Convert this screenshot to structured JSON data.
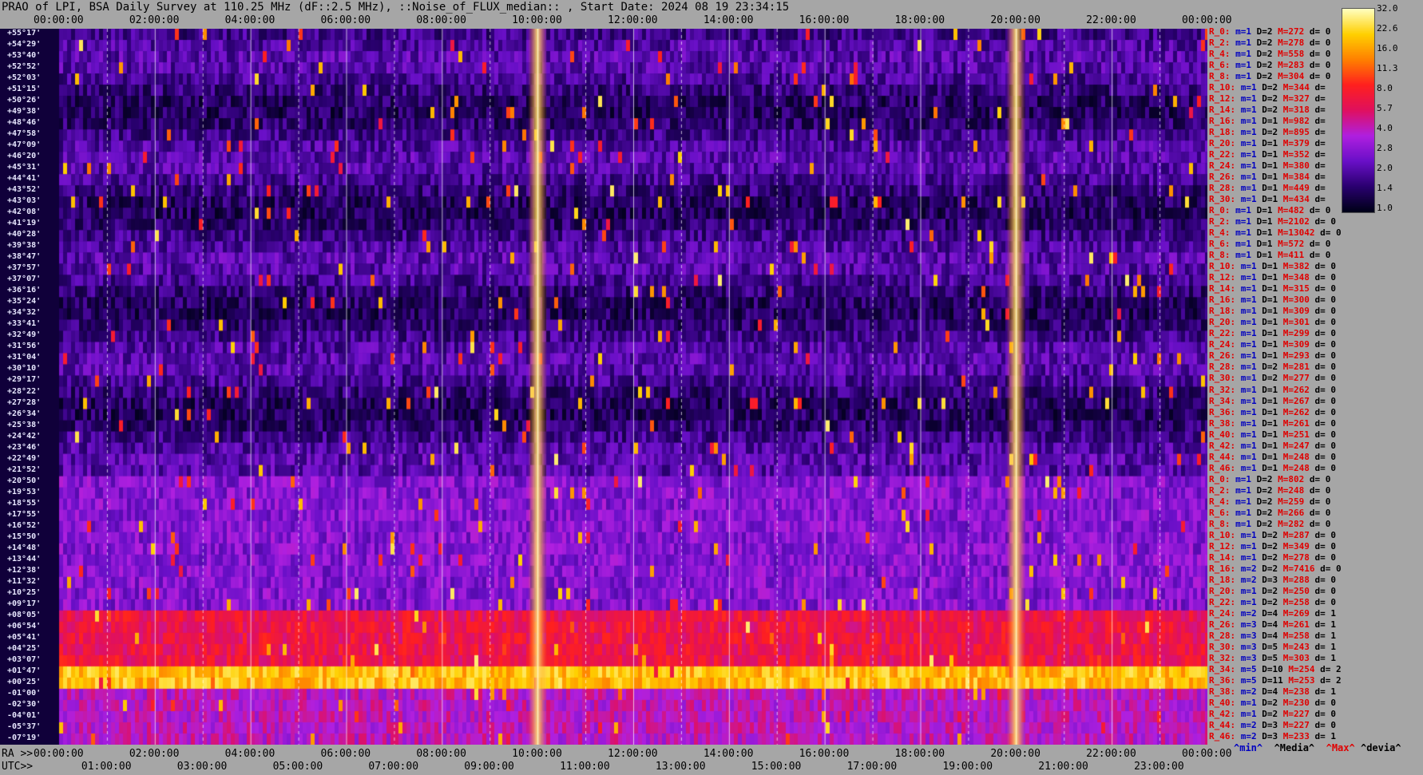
{
  "title": "PRAO of LPI, BSA Daily Survey at 110.25 MHz (dF::2.5 MHz), ::Noise_of_FLUX_median:: , Start Date: 2024 08 19 23:34:15",
  "top_time_labels": [
    "00:00:00",
    "02:00:00",
    "04:00:00",
    "06:00:00",
    "08:00:00",
    "10:00:00",
    "12:00:00",
    "14:00:00",
    "16:00:00",
    "18:00:00",
    "20:00:00",
    "22:00:00",
    "00:00:00"
  ],
  "bottom_ra_prefix": "RA >>",
  "bottom_ra_labels": [
    "00:00:00",
    "02:00:00",
    "04:00:00",
    "06:00:00",
    "08:00:00",
    "10:00:00",
    "12:00:00",
    "14:00:00",
    "16:00:00",
    "18:00:00",
    "20:00:00",
    "22:00:00",
    "00:00:00"
  ],
  "bottom_utc_prefix": "UTC>>",
  "bottom_utc_labels": [
    "01:00:00",
    "03:00:00",
    "05:00:00",
    "07:00:00",
    "09:00:00",
    "11:00:00",
    "13:00:00",
    "15:00:00",
    "17:00:00",
    "19:00:00",
    "21:00:00",
    "23:00:00"
  ],
  "declinations": [
    "+55°17'",
    "+54°29'",
    "+53°40'",
    "+52°52'",
    "+52°03'",
    "+51°15'",
    "+50°26'",
    "+49°38'",
    "+48°46'",
    "+47°58'",
    "+47°09'",
    "+46°20'",
    "+45°31'",
    "+44°41'",
    "+43°52'",
    "+43°03'",
    "+42°08'",
    "+41°19'",
    "+40°28'",
    "+39°38'",
    "+38°47'",
    "+37°57'",
    "+37°07'",
    "+36°16'",
    "+35°24'",
    "+34°32'",
    "+33°41'",
    "+32°49'",
    "+31°56'",
    "+31°04'",
    "+30°10'",
    "+29°17'",
    "+28°22'",
    "+27°28'",
    "+26°34'",
    "+25°38'",
    "+24°42'",
    "+23°46'",
    "+22°49'",
    "+21°52'",
    "+20°50'",
    "+19°53'",
    "+18°55'",
    "+17°55'",
    "+16°52'",
    "+15°50'",
    "+14°48'",
    "+13°44'",
    "+12°38'",
    "+11°32'",
    "+10°25'",
    "+09°17'",
    "+08°05'",
    "+06°54'",
    "+05°41'",
    "+04°25'",
    "+03°07'",
    "+01°47'",
    "+00°25'",
    "-01°00'",
    "-02°30'",
    "-04°01'",
    "-05°37'",
    "-07°19'"
  ],
  "row_labels": [
    "R_0:",
    "R_2:",
    "R_4:",
    "R_6:",
    "R_8:",
    "R_10:",
    "R_12:",
    "R_14:",
    "R_16:",
    "R_18:",
    "R_20:",
    "R_22:",
    "R_24:",
    "R_26:",
    "R_28:",
    "R_30:",
    "R_0:",
    "R_2:",
    "R_4:",
    "R_6:",
    "R_8:",
    "R_10:",
    "R_12:",
    "R_14:",
    "R_16:",
    "R_18:",
    "R_20:",
    "R_22:",
    "R_24:",
    "R_26:",
    "R_28:",
    "R_30:",
    "R_32:",
    "R_34:",
    "R_36:",
    "R_38:",
    "R_40:",
    "R_42:",
    "R_44:",
    "R_46:",
    "R_0:",
    "R_2:",
    "R_4:",
    "R_6:",
    "R_8:",
    "R_10:",
    "R_12:",
    "R_14:",
    "R_16:",
    "R_18:",
    "R_20:",
    "R_22:",
    "R_24:",
    "R_26:",
    "R_28:",
    "R_30:",
    "R_32:",
    "R_34:",
    "R_36:",
    "R_38:",
    "R_40:",
    "R_42:",
    "R_44:",
    "R_46:"
  ],
  "row_stats": [
    {
      "m": "m=1",
      "D": "D=2",
      "M": "M=272",
      "d": "d= 0"
    },
    {
      "m": "m=1",
      "D": "D=2",
      "M": "M=278",
      "d": "d= 0"
    },
    {
      "m": "m=1",
      "D": "D=2",
      "M": "M=558",
      "d": "d= 0"
    },
    {
      "m": "m=1",
      "D": "D=2",
      "M": "M=283",
      "d": "d= 0"
    },
    {
      "m": "m=1",
      "D": "D=2",
      "M": "M=304",
      "d": "d= 0"
    },
    {
      "m": "m=1",
      "D": "D=2",
      "M": "M=344",
      "d": "d="
    },
    {
      "m": "m=1",
      "D": "D=2",
      "M": "M=327",
      "d": "d="
    },
    {
      "m": "m=1",
      "D": "D=2",
      "M": "M=318",
      "d": "d="
    },
    {
      "m": "m=1",
      "D": "D=1",
      "M": "M=982",
      "d": "d="
    },
    {
      "m": "m=1",
      "D": "D=2",
      "M": "M=895",
      "d": "d="
    },
    {
      "m": "m=1",
      "D": "D=1",
      "M": "M=379",
      "d": "d="
    },
    {
      "m": "m=1",
      "D": "D=1",
      "M": "M=352",
      "d": "d="
    },
    {
      "m": "m=1",
      "D": "D=1",
      "M": "M=380",
      "d": "d="
    },
    {
      "m": "m=1",
      "D": "D=1",
      "M": "M=384",
      "d": "d="
    },
    {
      "m": "m=1",
      "D": "D=1",
      "M": "M=449",
      "d": "d="
    },
    {
      "m": "m=1",
      "D": "D=1",
      "M": "M=434",
      "d": "d="
    },
    {
      "m": "m=1",
      "D": "D=1",
      "M": "M=482",
      "d": "d= 0"
    },
    {
      "m": "m=1",
      "D": "D=1",
      "M": "M=2102",
      "d": "d= 0"
    },
    {
      "m": "m=1",
      "D": "D=1",
      "M": "M=13042",
      "d": "d= 0"
    },
    {
      "m": "m=1",
      "D": "D=1",
      "M": "M=572",
      "d": "d= 0"
    },
    {
      "m": "m=1",
      "D": "D=1",
      "M": "M=411",
      "d": "d= 0"
    },
    {
      "m": "m=1",
      "D": "D=1",
      "M": "M=382",
      "d": "d= 0"
    },
    {
      "m": "m=1",
      "D": "D=1",
      "M": "M=348",
      "d": "d= 0"
    },
    {
      "m": "m=1",
      "D": "D=1",
      "M": "M=315",
      "d": "d= 0"
    },
    {
      "m": "m=1",
      "D": "D=1",
      "M": "M=300",
      "d": "d= 0"
    },
    {
      "m": "m=1",
      "D": "D=1",
      "M": "M=309",
      "d": "d= 0"
    },
    {
      "m": "m=1",
      "D": "D=1",
      "M": "M=301",
      "d": "d= 0"
    },
    {
      "m": "m=1",
      "D": "D=1",
      "M": "M=299",
      "d": "d= 0"
    },
    {
      "m": "m=1",
      "D": "D=1",
      "M": "M=309",
      "d": "d= 0"
    },
    {
      "m": "m=1",
      "D": "D=1",
      "M": "M=293",
      "d": "d= 0"
    },
    {
      "m": "m=1",
      "D": "D=2",
      "M": "M=281",
      "d": "d= 0"
    },
    {
      "m": "m=1",
      "D": "D=2",
      "M": "M=277",
      "d": "d= 0"
    },
    {
      "m": "m=1",
      "D": "D=1",
      "M": "M=262",
      "d": "d= 0"
    },
    {
      "m": "m=1",
      "D": "D=1",
      "M": "M=267",
      "d": "d= 0"
    },
    {
      "m": "m=1",
      "D": "D=1",
      "M": "M=262",
      "d": "d= 0"
    },
    {
      "m": "m=1",
      "D": "D=1",
      "M": "M=261",
      "d": "d= 0"
    },
    {
      "m": "m=1",
      "D": "D=1",
      "M": "M=251",
      "d": "d= 0"
    },
    {
      "m": "m=1",
      "D": "D=1",
      "M": "M=247",
      "d": "d= 0"
    },
    {
      "m": "m=1",
      "D": "D=1",
      "M": "M=248",
      "d": "d= 0"
    },
    {
      "m": "m=1",
      "D": "D=1",
      "M": "M=248",
      "d": "d= 0"
    },
    {
      "m": "m=1",
      "D": "D=2",
      "M": "M=802",
      "d": "d= 0"
    },
    {
      "m": "m=1",
      "D": "D=2",
      "M": "M=248",
      "d": "d= 0"
    },
    {
      "m": "m=1",
      "D": "D=2",
      "M": "M=259",
      "d": "d= 0"
    },
    {
      "m": "m=1",
      "D": "D=2",
      "M": "M=266",
      "d": "d= 0"
    },
    {
      "m": "m=1",
      "D": "D=2",
      "M": "M=282",
      "d": "d= 0"
    },
    {
      "m": "m=1",
      "D": "D=2",
      "M": "M=287",
      "d": "d= 0"
    },
    {
      "m": "m=1",
      "D": "D=2",
      "M": "M=349",
      "d": "d= 0"
    },
    {
      "m": "m=1",
      "D": "D=2",
      "M": "M=278",
      "d": "d= 0"
    },
    {
      "m": "m=2",
      "D": "D=2",
      "M": "M=7416",
      "d": "d= 0"
    },
    {
      "m": "m=2",
      "D": "D=3",
      "M": "M=288",
      "d": "d= 0"
    },
    {
      "m": "m=1",
      "D": "D=2",
      "M": "M=250",
      "d": "d= 0"
    },
    {
      "m": "m=1",
      "D": "D=2",
      "M": "M=258",
      "d": "d= 0"
    },
    {
      "m": "m=2",
      "D": "D=4",
      "M": "M=269",
      "d": "d= 1"
    },
    {
      "m": "m=3",
      "D": "D=4",
      "M": "M=261",
      "d": "d= 1"
    },
    {
      "m": "m=3",
      "D": "D=4",
      "M": "M=258",
      "d": "d= 1"
    },
    {
      "m": "m=3",
      "D": "D=5",
      "M": "M=243",
      "d": "d= 1"
    },
    {
      "m": "m=3",
      "D": "D=5",
      "M": "M=303",
      "d": "d= 1"
    },
    {
      "m": "m=5",
      "D": "D=10",
      "M": "M=254",
      "d": "d= 2"
    },
    {
      "m": "m=5",
      "D": "D=11",
      "M": "M=253",
      "d": "d= 2"
    },
    {
      "m": "m=2",
      "D": "D=4",
      "M": "M=238",
      "d": "d= 1"
    },
    {
      "m": "m=1",
      "D": "D=2",
      "M": "M=230",
      "d": "d= 0"
    },
    {
      "m": "m=1",
      "D": "D=2",
      "M": "M=227",
      "d": "d= 0"
    },
    {
      "m": "m=2",
      "D": "D=3",
      "M": "M=227",
      "d": "d= 0"
    },
    {
      "m": "m=2",
      "D": "D=3",
      "M": "M=233",
      "d": "d= 1"
    }
  ],
  "legend": {
    "min": "^min^",
    "median": "^Media^",
    "max": "^Max^",
    "dev": "^devia^"
  },
  "colorbar_ticks": [
    "32.0",
    "22.6",
    "16.0",
    "11.3",
    "8.0",
    "5.7",
    "4.0",
    "2.8",
    "2.0",
    "1.4",
    "1.0"
  ],
  "chart_data": {
    "type": "heatmap",
    "title": "PRAO of LPI, BSA Daily Survey at 110.25 MHz (dF::2.5 MHz), ::Noise_of_FLUX_median:: , Start Date: 2024 08 19 23:34:15",
    "x_axis_top": "RA 00:00:00 – 24:00:00",
    "colorscale": [
      "#000018",
      "#2a0070",
      "#6a10c8",
      "#b020e0",
      "#e01060",
      "#ff2020",
      "#ff8000",
      "#ffd000",
      "#ffffc0"
    ],
    "colorbar_range": [
      1.0,
      32.0
    ],
    "features": [
      {
        "name": "bright vertical band",
        "ra_hours": 20.0
      },
      {
        "name": "bright vertical band",
        "ra_hours": 10.0
      },
      {
        "name": "bright horizontal band",
        "dec": "+00°25'"
      }
    ]
  }
}
